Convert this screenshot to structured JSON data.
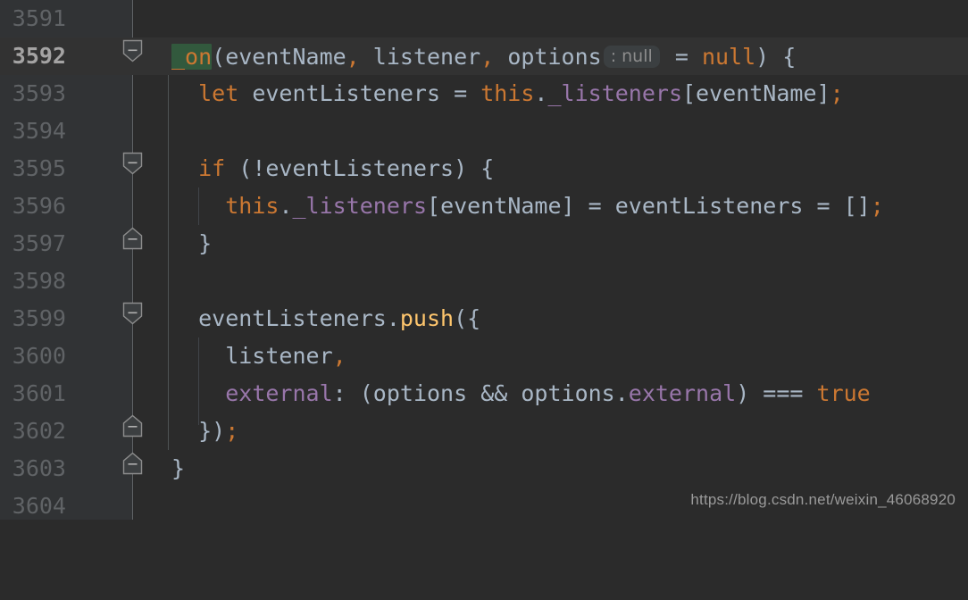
{
  "editor": {
    "theme": "darcula",
    "background": "#2b2b2b",
    "gutter_background": "#313335",
    "caret_line_background": "#323232",
    "default_text_color": "#a9b7c6",
    "line_number_color": "#606366",
    "caret_line_number_color": "#a4a3a3",
    "colors": {
      "keyword": "#cc7832",
      "function": "#ffc66d",
      "property": "#9876aa",
      "identifier_highlight_bg": "#32593d",
      "inlay_hint_bg": "#3b3f41",
      "inlay_hint_text": "#8c8c8c",
      "indent_guide": "#4e5254",
      "fold_marker": "#8d8d8d"
    },
    "first_visible_line": 3591,
    "last_visible_line": 3604,
    "caret_line": 3592,
    "lines": [
      {
        "number": "3591",
        "text": "",
        "fold": "none",
        "caret": false,
        "indent_guides": 0
      },
      {
        "number": "3592",
        "text": "_on(eventName, listener, options : null = null) {",
        "fold": "open",
        "caret": true,
        "indent_guides": 0
      },
      {
        "number": "3593",
        "text": "  let eventListeners = this._listeners[eventName];",
        "fold": "none",
        "caret": false,
        "indent_guides": 1
      },
      {
        "number": "3594",
        "text": "",
        "fold": "none",
        "caret": false,
        "indent_guides": 1
      },
      {
        "number": "3595",
        "text": "  if (!eventListeners) {",
        "fold": "open",
        "caret": false,
        "indent_guides": 1
      },
      {
        "number": "3596",
        "text": "    this._listeners[eventName] = eventListeners = [];",
        "fold": "none",
        "caret": false,
        "indent_guides": 2
      },
      {
        "number": "3597",
        "text": "  }",
        "fold": "close",
        "caret": false,
        "indent_guides": 1
      },
      {
        "number": "3598",
        "text": "",
        "fold": "none",
        "caret": false,
        "indent_guides": 1
      },
      {
        "number": "3599",
        "text": "  eventListeners.push({",
        "fold": "open",
        "caret": false,
        "indent_guides": 1
      },
      {
        "number": "3600",
        "text": "    listener,",
        "fold": "none",
        "caret": false,
        "indent_guides": 2
      },
      {
        "number": "3601",
        "text": "    external: (options && options.external) === true",
        "fold": "none",
        "caret": false,
        "indent_guides": 2
      },
      {
        "number": "3602",
        "text": "  });",
        "fold": "close",
        "caret": false,
        "indent_guides": 1
      },
      {
        "number": "3603",
        "text": "}",
        "fold": "close",
        "caret": false,
        "indent_guides": 0
      },
      {
        "number": "3604",
        "text": "",
        "fold": "none",
        "caret": false,
        "indent_guides": 0
      }
    ],
    "inlay_hints": [
      {
        "line": "3592",
        "text": ": null",
        "after_token": "options"
      }
    ]
  },
  "watermark": {
    "text": "https://blog.csdn.net/weixin_46068920"
  }
}
